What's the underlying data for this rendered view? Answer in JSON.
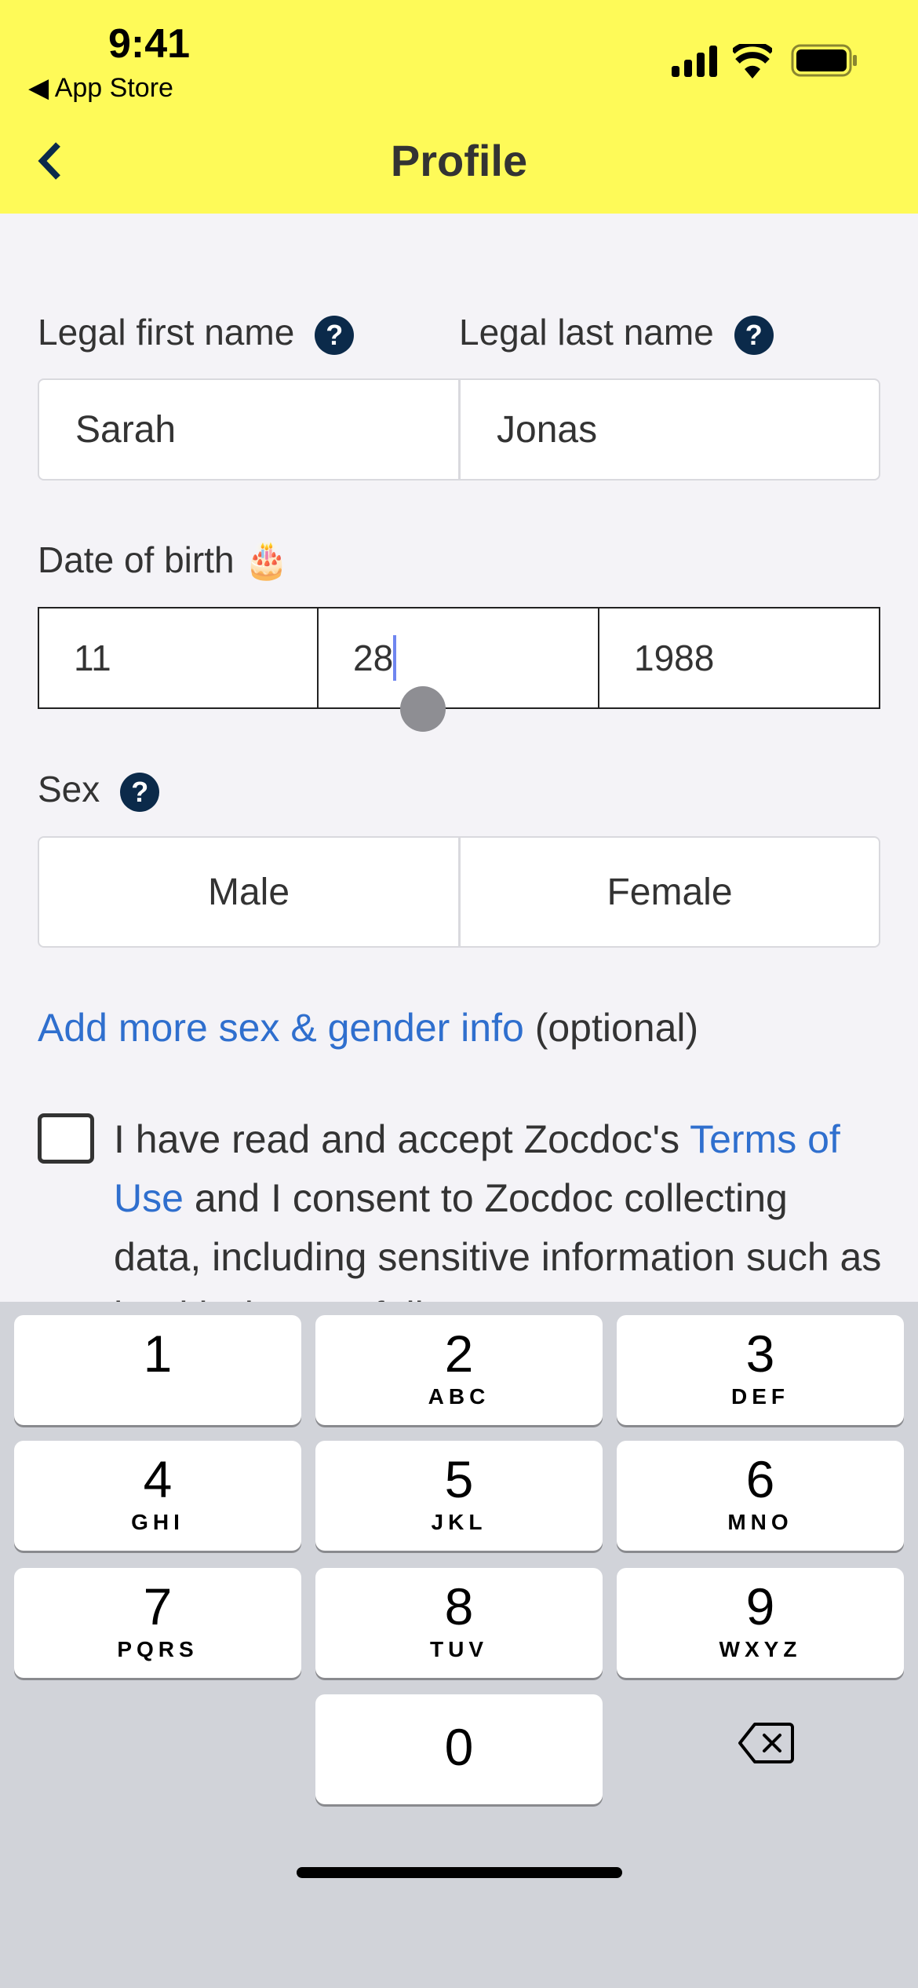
{
  "status_bar": {
    "time": "9:41",
    "back_app": "App Store"
  },
  "header": {
    "title": "Profile"
  },
  "form": {
    "first_name_label": "Legal first name",
    "first_name_value": "Sarah",
    "last_name_label": "Legal last name",
    "last_name_value": "Jonas",
    "dob_label": "Date of birth",
    "dob_emoji": "🎂",
    "dob_month": "11",
    "dob_day": "28",
    "dob_year": "1988",
    "sex_label": "Sex",
    "sex_options": [
      "Male",
      "Female"
    ],
    "help_glyph": "?",
    "more_info_link": "Add more sex & gender info",
    "more_info_suffix": "(optional)",
    "consent_pre": "I have read and accept Zocdoc's ",
    "consent_link": "Terms of Use",
    "consent_post": " and I consent to Zocdoc collecting data, including sensitive information such as health data, to fully"
  },
  "keyboard": {
    "keys": [
      {
        "d": "1",
        "l": ""
      },
      {
        "d": "2",
        "l": "ABC"
      },
      {
        "d": "3",
        "l": "DEF"
      },
      {
        "d": "4",
        "l": "GHI"
      },
      {
        "d": "5",
        "l": "JKL"
      },
      {
        "d": "6",
        "l": "MNO"
      },
      {
        "d": "7",
        "l": "PQRS"
      },
      {
        "d": "8",
        "l": "TUV"
      },
      {
        "d": "9",
        "l": "WXYZ"
      },
      {
        "d": "0",
        "l": ""
      }
    ],
    "delete_icon": "backspace-icon"
  },
  "colors": {
    "header": "#fefa58",
    "link": "#2f6fce",
    "help": "#0b2a4a"
  }
}
